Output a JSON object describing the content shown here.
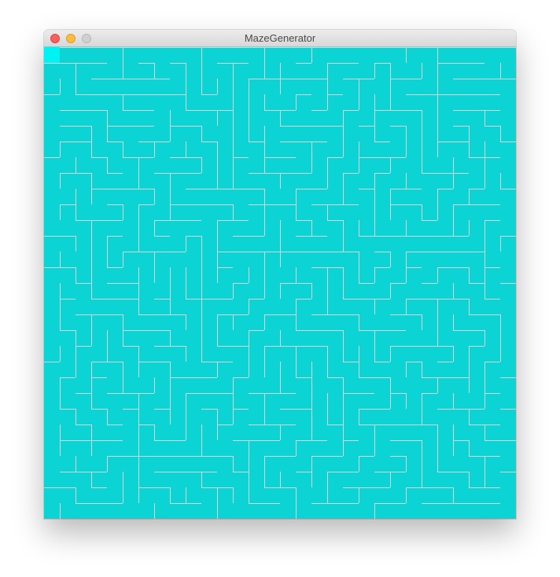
{
  "window": {
    "title": "MazeGenerator"
  },
  "maze": {
    "rows": 30,
    "cols": 30,
    "background_color": "#0cd4d4",
    "wall_color": "#8ff3f3",
    "current_cell_color": "#00f2f2",
    "current_cell": {
      "row": 0,
      "col": 0
    }
  }
}
